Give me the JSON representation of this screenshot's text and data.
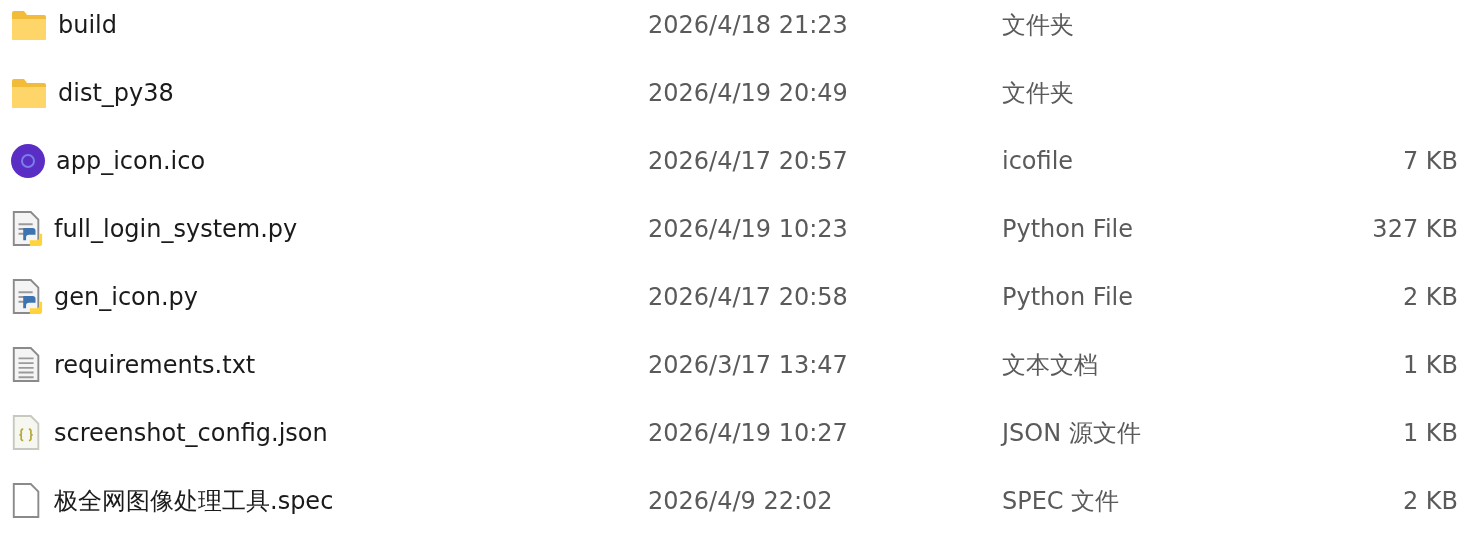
{
  "files": [
    {
      "kind": "folder",
      "name": "build",
      "modified": "2026/4/18 21:23",
      "type": "文件夹"
    },
    {
      "kind": "folder",
      "name": "dist_py38",
      "modified": "2026/4/19 20:49",
      "type": "文件夹"
    },
    {
      "kind": "ico",
      "name": "app_icon.ico",
      "modified": "2026/4/17 20:57",
      "type": "icofile",
      "size": "7 KB"
    },
    {
      "kind": "python",
      "name": "full_login_system.py",
      "modified": "2026/4/19 10:23",
      "type": "Python File",
      "size": "327 KB"
    },
    {
      "kind": "python",
      "name": "gen_icon.py",
      "modified": "2026/4/17 20:58",
      "type": "Python File",
      "size": "2 KB"
    },
    {
      "kind": "text",
      "name": "requirements.txt",
      "modified": "2026/3/17 13:47",
      "type": "文本文档",
      "size": "1 KB"
    },
    {
      "kind": "json",
      "name": "screenshot_config.json",
      "modified": "2026/4/19 10:27",
      "type": "JSON 源文件",
      "size": "1 KB"
    },
    {
      "kind": "blank",
      "name": "极全网图像处理工具.spec",
      "modified": "2026/4/9 22:02",
      "type": "SPEC 文件",
      "size": "2 KB"
    }
  ]
}
